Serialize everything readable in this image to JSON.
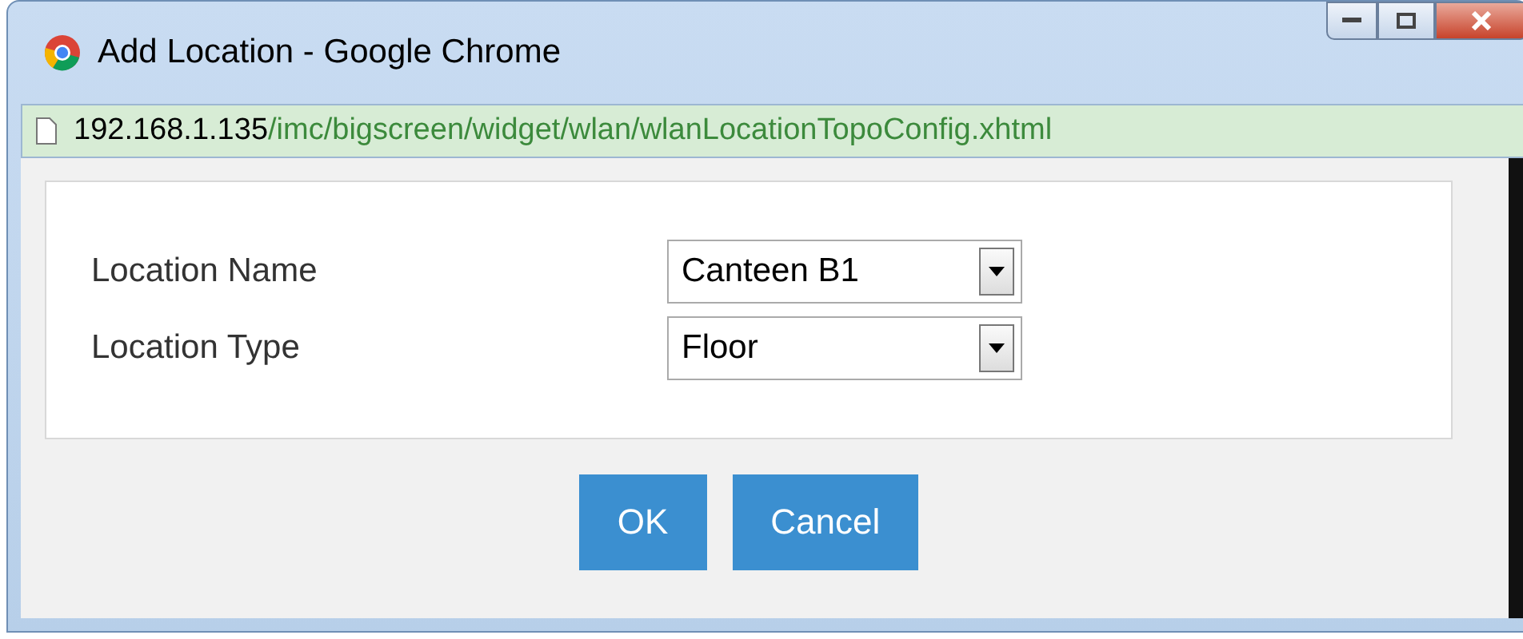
{
  "window": {
    "title": "Add Location - Google Chrome"
  },
  "address_bar": {
    "host": "192.168.1.135",
    "path": "/imc/bigscreen/widget/wlan/wlanLocationTopoConfig.xhtml"
  },
  "form": {
    "fields": [
      {
        "label": "Location Name",
        "value": "Canteen B1"
      },
      {
        "label": "Location Type",
        "value": "Floor"
      }
    ]
  },
  "buttons": [
    "OK",
    "Cancel"
  ]
}
